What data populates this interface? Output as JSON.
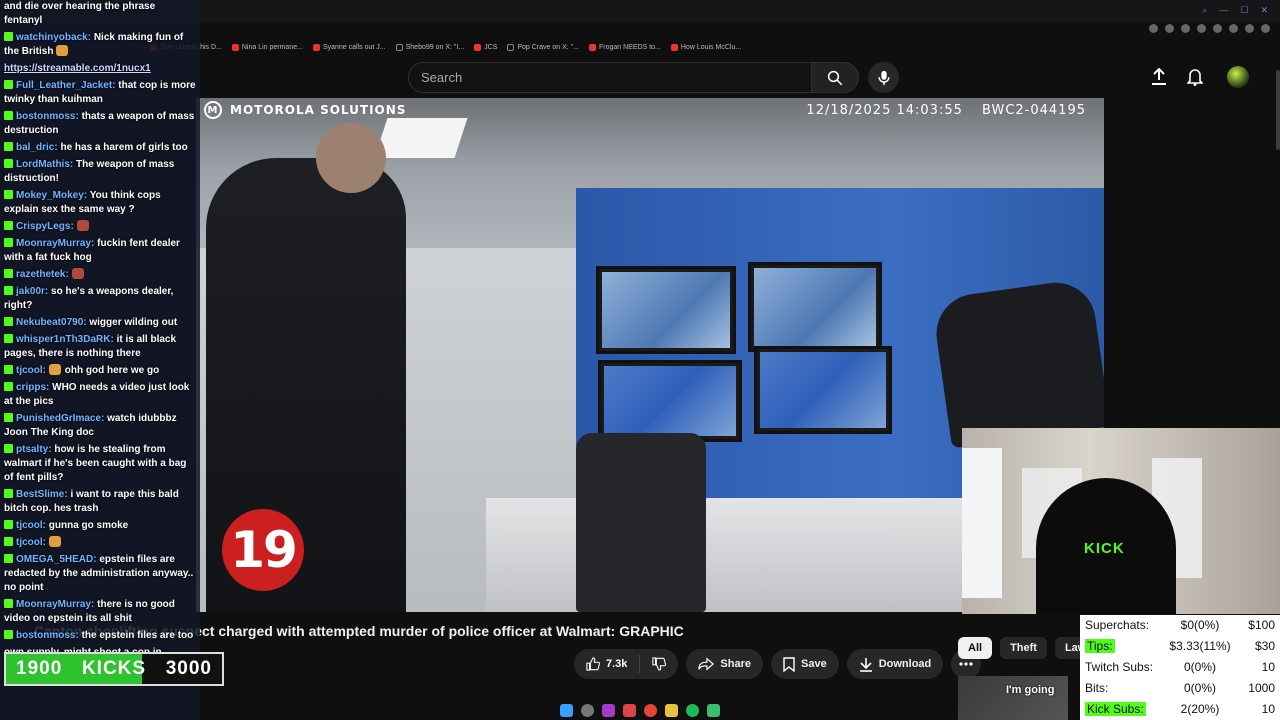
{
  "browser": {
    "bookmarks": [
      {
        "label": "Tom Unveils his D..."
      },
      {
        "label": "Nina Lin permane..."
      },
      {
        "label": "Syanne calls out J..."
      },
      {
        "label": "Shebo99 on X: \"I..."
      },
      {
        "label": "JCS"
      },
      {
        "label": "Pop Crave on X: \"..."
      },
      {
        "label": "Frogan NEEDS to..."
      },
      {
        "label": "How Louis McClu..."
      }
    ]
  },
  "yt": {
    "search_placeholder": "Search"
  },
  "video": {
    "brand": "MOTOROLA SOLUTIONS",
    "timestamp": "12/18/2025 14:03:55",
    "camera_id": "BWC2-044195",
    "channel_badge": "19",
    "title": "Canton shoplifting suspect charged with attempted murder of police officer at Walmart: GRAPHIC",
    "likes": "7.3k",
    "share_label": "Share",
    "save_label": "Save",
    "download_label": "Download"
  },
  "chips": [
    {
      "label": "All",
      "active": true
    },
    {
      "label": "Theft",
      "active": false
    },
    {
      "label": "Law e",
      "active": false
    }
  ],
  "related": {
    "thumb_text": "I'm going"
  },
  "chat": {
    "messages": [
      {
        "user": "",
        "text": "and die over hearing the phrase fentanyl"
      },
      {
        "user": "watchinyoback",
        "text": "Nick making fun of the British",
        "emote": true
      },
      {
        "user": "",
        "text": "https://streamable.com/1nucx1",
        "link": true
      },
      {
        "user": "Full_Leather_Jacket",
        "text": "that cop is more twinky than kuihman"
      },
      {
        "user": "bostonmoss",
        "text": "thats a weapon of mass destruction"
      },
      {
        "user": "bal_dric",
        "text": "he has a harem of girls too"
      },
      {
        "user": "LordMathis",
        "text": "The weapon of mass distruction!"
      },
      {
        "user": "Mokey_Mokey",
        "text": "You think cops explain sex the same way ?"
      },
      {
        "user": "CrispyLegs",
        "text": "",
        "emote_pic": true
      },
      {
        "user": "MoonrayMurray",
        "text": "fuckin fent dealer with a fat fuck hog"
      },
      {
        "user": "razethetek",
        "text": "",
        "emote_pic": true
      },
      {
        "user": "jak00r",
        "text": "so he's a weapons dealer, right?"
      },
      {
        "user": "Nekubeat0790",
        "text": "wigger wilding out"
      },
      {
        "user": "whisper1nTh3DaRK",
        "text": "it is all black pages, there is nothing there"
      },
      {
        "user": "tjcool",
        "text": "ohh god here we go",
        "emote": true
      },
      {
        "user": "cripps",
        "text": "WHO needs a video just look at the pics"
      },
      {
        "user": "PunishedGrImace",
        "text": "watch idubbbz Joon The King doc"
      },
      {
        "user": "ptsalty",
        "text": "how is he stealing from walmart if he's been caught with a bag of fent pills?"
      },
      {
        "user": "BestSlime",
        "text": "i want to rape this bald bitch cop. hes trash"
      },
      {
        "user": "tjcool",
        "text": "gunna go smoke"
      },
      {
        "user": "tjcool",
        "text": "",
        "emote": true
      },
      {
        "user": "OMEGA_5HEAD",
        "text": "epstein files are redacted by the administration anyway.. no point"
      },
      {
        "user": "MoonrayMurray",
        "text": "there is no good video on epstein its all shit"
      },
      {
        "user": "bostonmoss",
        "text": "the epstein files are too"
      },
      {
        "user": "",
        "text": "own supply, might shoot a cop in Walmart"
      }
    ],
    "kicks_left": "1900",
    "kicks_mid": "KICKS",
    "kicks_right": "3000",
    "kicks_progress": 0.63
  },
  "webcam": {
    "logo": "KICK"
  },
  "stats": [
    {
      "label": "Superchats:",
      "value": "$0(0%)",
      "goal": "$100",
      "highlight": false
    },
    {
      "label": "Tips:",
      "value": "$3.33(11%)",
      "goal": "$30",
      "highlight": true
    },
    {
      "label": "Twitch Subs:",
      "value": "0(0%)",
      "goal": "10",
      "highlight": false
    },
    {
      "label": "Bits:",
      "value": "0(0%)",
      "goal": "1000",
      "highlight": false
    },
    {
      "label": "Kick Subs:",
      "value": "2(20%)",
      "goal": "10",
      "highlight": true
    }
  ],
  "colors": {
    "kick_green": "#53fc18",
    "chat_user": "#6fb4ff",
    "yt_bg": "#0f0f0f"
  }
}
